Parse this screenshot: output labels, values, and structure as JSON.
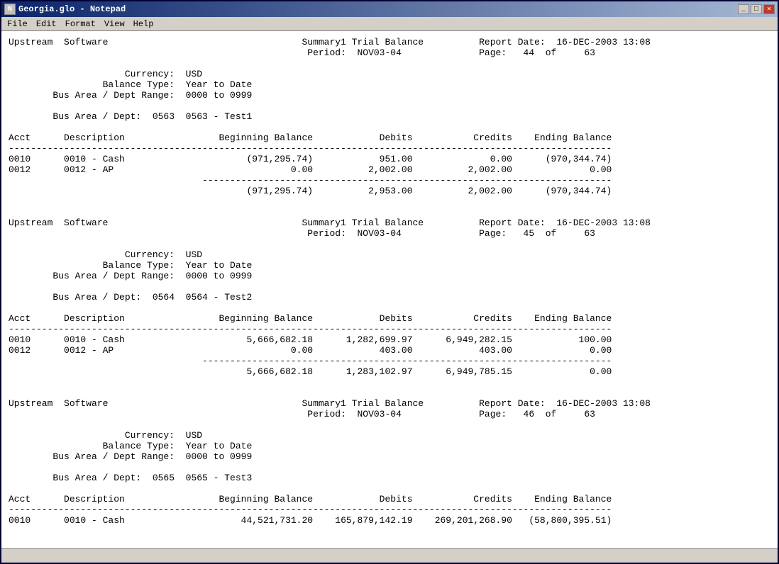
{
  "window": {
    "title": "Georgia.glo - Notepad",
    "icon": "N"
  },
  "menubar": {
    "items": [
      "File",
      "Edit",
      "Format",
      "View",
      "Help"
    ]
  },
  "sections": [
    {
      "id": "section1",
      "company": "Upstream  Software",
      "report_title": "Summary1 Trial Balance",
      "period_label": "Period:",
      "period": "NOV03-04",
      "report_date_label": "Report Date:",
      "report_date": "16-DEC-2003 13:08",
      "page_label": "Page:",
      "page_num": "44",
      "page_of": "of",
      "page_total": "63",
      "currency_label": "Currency:",
      "currency": "USD",
      "balance_type_label": "Balance Type:",
      "balance_type": "Year to Date",
      "dept_range_label": "Bus Area / Dept Range:",
      "dept_range": "0000 to 0999",
      "bus_dept_label": "Bus Area / Dept:",
      "bus_dept": "0563  0563 - Test1",
      "columns": [
        "Acct",
        "Description",
        "Beginning Balance",
        "Debits",
        "Credits",
        "Ending Balance"
      ],
      "rows": [
        {
          "acct": "0010",
          "desc": "0010 - Cash",
          "beg_bal": "(971,295.74)",
          "debits": "951.00",
          "credits": "0.00",
          "end_bal": "(970,344.74)"
        },
        {
          "acct": "0012",
          "desc": "0012 - AP",
          "beg_bal": "0.00",
          "debits": "2,002.00",
          "credits": "2,002.00",
          "end_bal": "0.00"
        }
      ],
      "totals": {
        "beg_bal": "(971,295.74)",
        "debits": "2,953.00",
        "credits": "2,002.00",
        "end_bal": "(970,344.74)"
      }
    },
    {
      "id": "section2",
      "company": "Upstream  Software",
      "report_title": "Summary1 Trial Balance",
      "period_label": "Period:",
      "period": "NOV03-04",
      "report_date_label": "Report Date:",
      "report_date": "16-DEC-2003 13:08",
      "page_label": "Page:",
      "page_num": "45",
      "page_of": "of",
      "page_total": "63",
      "currency_label": "Currency:",
      "currency": "USD",
      "balance_type_label": "Balance Type:",
      "balance_type": "Year to Date",
      "dept_range_label": "Bus Area / Dept Range:",
      "dept_range": "0000 to 0999",
      "bus_dept_label": "Bus Area / Dept:",
      "bus_dept": "0564  0564 - Test2",
      "columns": [
        "Acct",
        "Description",
        "Beginning Balance",
        "Debits",
        "Credits",
        "Ending Balance"
      ],
      "rows": [
        {
          "acct": "0010",
          "desc": "0010 - Cash",
          "beg_bal": "5,666,682.18",
          "debits": "1,282,699.97",
          "credits": "6,949,282.15",
          "end_bal": "100.00"
        },
        {
          "acct": "0012",
          "desc": "0012 - AP",
          "beg_bal": "0.00",
          "debits": "403.00",
          "credits": "403.00",
          "end_bal": "0.00"
        }
      ],
      "totals": {
        "beg_bal": "5,666,682.18",
        "debits": "1,283,102.97",
        "credits": "6,949,785.15",
        "end_bal": "0.00"
      }
    },
    {
      "id": "section3",
      "company": "Upstream  Software",
      "report_title": "Summary1 Trial Balance",
      "period_label": "Period:",
      "period": "NOV03-04",
      "report_date_label": "Report Date:",
      "report_date": "16-DEC-2003 13:08",
      "page_label": "Page:",
      "page_num": "46",
      "page_of": "of",
      "page_total": "63",
      "currency_label": "Currency:",
      "currency": "USD",
      "balance_type_label": "Balance Type:",
      "balance_type": "Year to Date",
      "dept_range_label": "Bus Area / Dept Range:",
      "dept_range": "0000 to 0999",
      "bus_dept_label": "Bus Area / Dept:",
      "bus_dept": "0565  0565 - Test3",
      "columns": [
        "Acct",
        "Description",
        "Beginning Balance",
        "Debits",
        "Credits",
        "Ending Balance"
      ],
      "rows": [
        {
          "acct": "0010",
          "desc": "0010 - Cash",
          "beg_bal": "44,521,731.20",
          "debits": "165,879,142.19",
          "credits": "269,201,268.90",
          "end_bal": "(58,800,395.51)"
        }
      ],
      "totals": null
    }
  ]
}
